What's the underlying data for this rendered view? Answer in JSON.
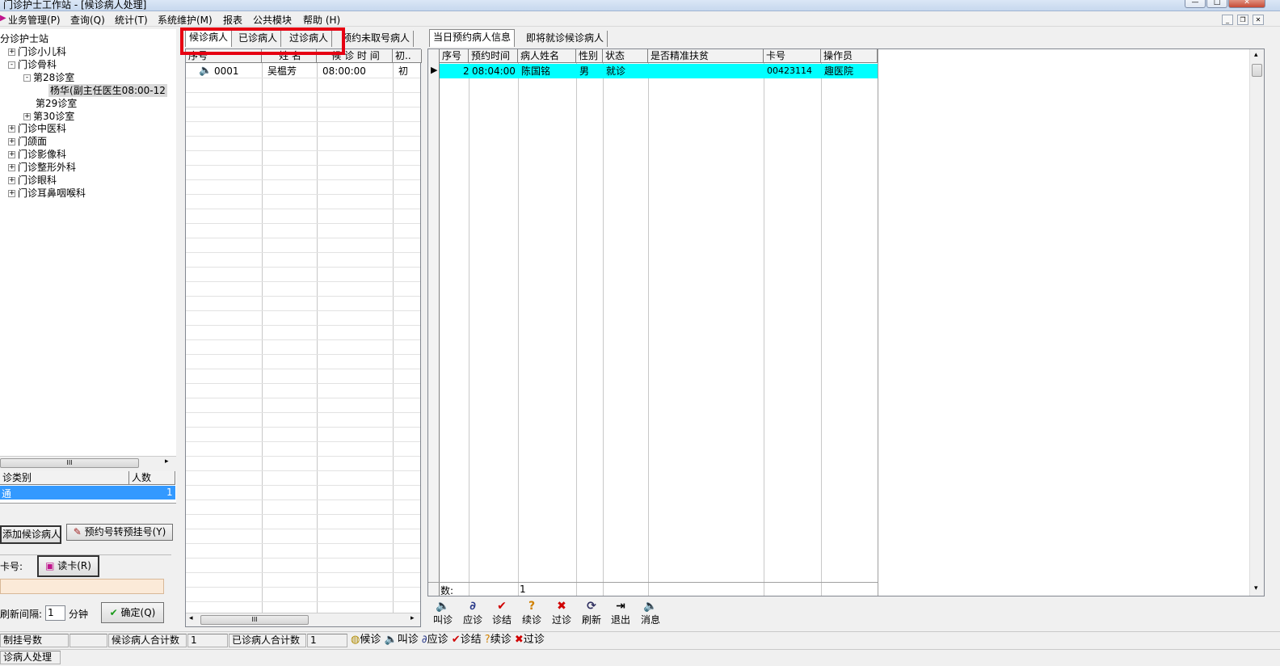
{
  "window": {
    "title": "门诊护士工作站 - [候诊病人处理]"
  },
  "menu": [
    "业务管理(P)",
    "查询(Q)",
    "统计(T)",
    "系统维护(M)",
    "报表",
    "公共模块",
    "帮助 (H)"
  ],
  "tree": {
    "root": "分诊护士站",
    "items": [
      {
        "label": "门诊小儿科",
        "expander": "+"
      },
      {
        "label": "门诊骨科",
        "expander": "-"
      },
      {
        "label": "第28诊室",
        "expander": "-"
      },
      {
        "label": "杨华(副主任医生08:00-12",
        "expander": ""
      },
      {
        "label": "第29诊室",
        "expander": ""
      },
      {
        "label": "第30诊室",
        "expander": "+"
      },
      {
        "label": "门诊中医科",
        "expander": "+"
      },
      {
        "label": "门颌面",
        "expander": "+"
      },
      {
        "label": "门诊影像科",
        "expander": "+"
      },
      {
        "label": "门诊整形外科",
        "expander": "+"
      },
      {
        "label": "门诊眼科",
        "expander": "+"
      },
      {
        "label": "门诊耳鼻咽喉科",
        "expander": "+"
      }
    ],
    "hscroll_label": "III"
  },
  "category_grid": {
    "headers": [
      "诊类别",
      "人数"
    ],
    "row": {
      "name": "通",
      "count": "1"
    }
  },
  "left_buttons": {
    "add_waiting": "添加候诊病人",
    "convert": "预约号转预挂号(Y)",
    "card_label": "卡号:",
    "read_card": "读卡(R)",
    "refresh_label": "刷新间隔:",
    "refresh_value": "1",
    "minutes": "分钟",
    "confirm": "确定(Q)"
  },
  "middle_tabs": [
    "候诊病人",
    "已诊病人",
    "过诊病人",
    "预约未取号病人"
  ],
  "waiting_grid": {
    "headers": [
      "序号",
      "姓 名",
      "候 诊 时 间",
      "初.."
    ],
    "rows": [
      {
        "no": "0001",
        "name": "吴榅芳",
        "time": "08:00:00",
        "type": "初"
      }
    ],
    "hscroll_label": "III"
  },
  "right_tabs": [
    "当日预约病人信息",
    "即将就诊候诊病人"
  ],
  "appointment_grid": {
    "headers": [
      "序号",
      "预约时间",
      "病人姓名",
      "性别",
      "状态",
      "是否精准扶贫",
      "卡号",
      "操作员"
    ],
    "rows": [
      {
        "no": "2",
        "time": "08:04:00",
        "name": "陈国铭",
        "sex": "男",
        "status": "就诊",
        "poverty": "",
        "card": "00423114",
        "operator": "趣医院"
      }
    ],
    "footer_label": "数:",
    "footer_count": "1",
    "row_highlight": "#00ffff"
  },
  "toolbar": [
    "叫诊",
    "应诊",
    "诊结",
    "续诊",
    "过诊",
    "刷新",
    "退出",
    "消息"
  ],
  "status_bar": {
    "cells": [
      "制挂号数",
      "",
      "候诊病人合计数",
      "1",
      "已诊病人合计数",
      "1"
    ],
    "legend": [
      "候诊",
      "叫诊",
      "应诊",
      "诊结",
      "续诊",
      "过诊"
    ],
    "bottom": "诊病人处理"
  },
  "colors": {
    "highlight_tab_border": "#e60012",
    "selection": "#3399ff",
    "row_highlight": "#00ffff"
  }
}
